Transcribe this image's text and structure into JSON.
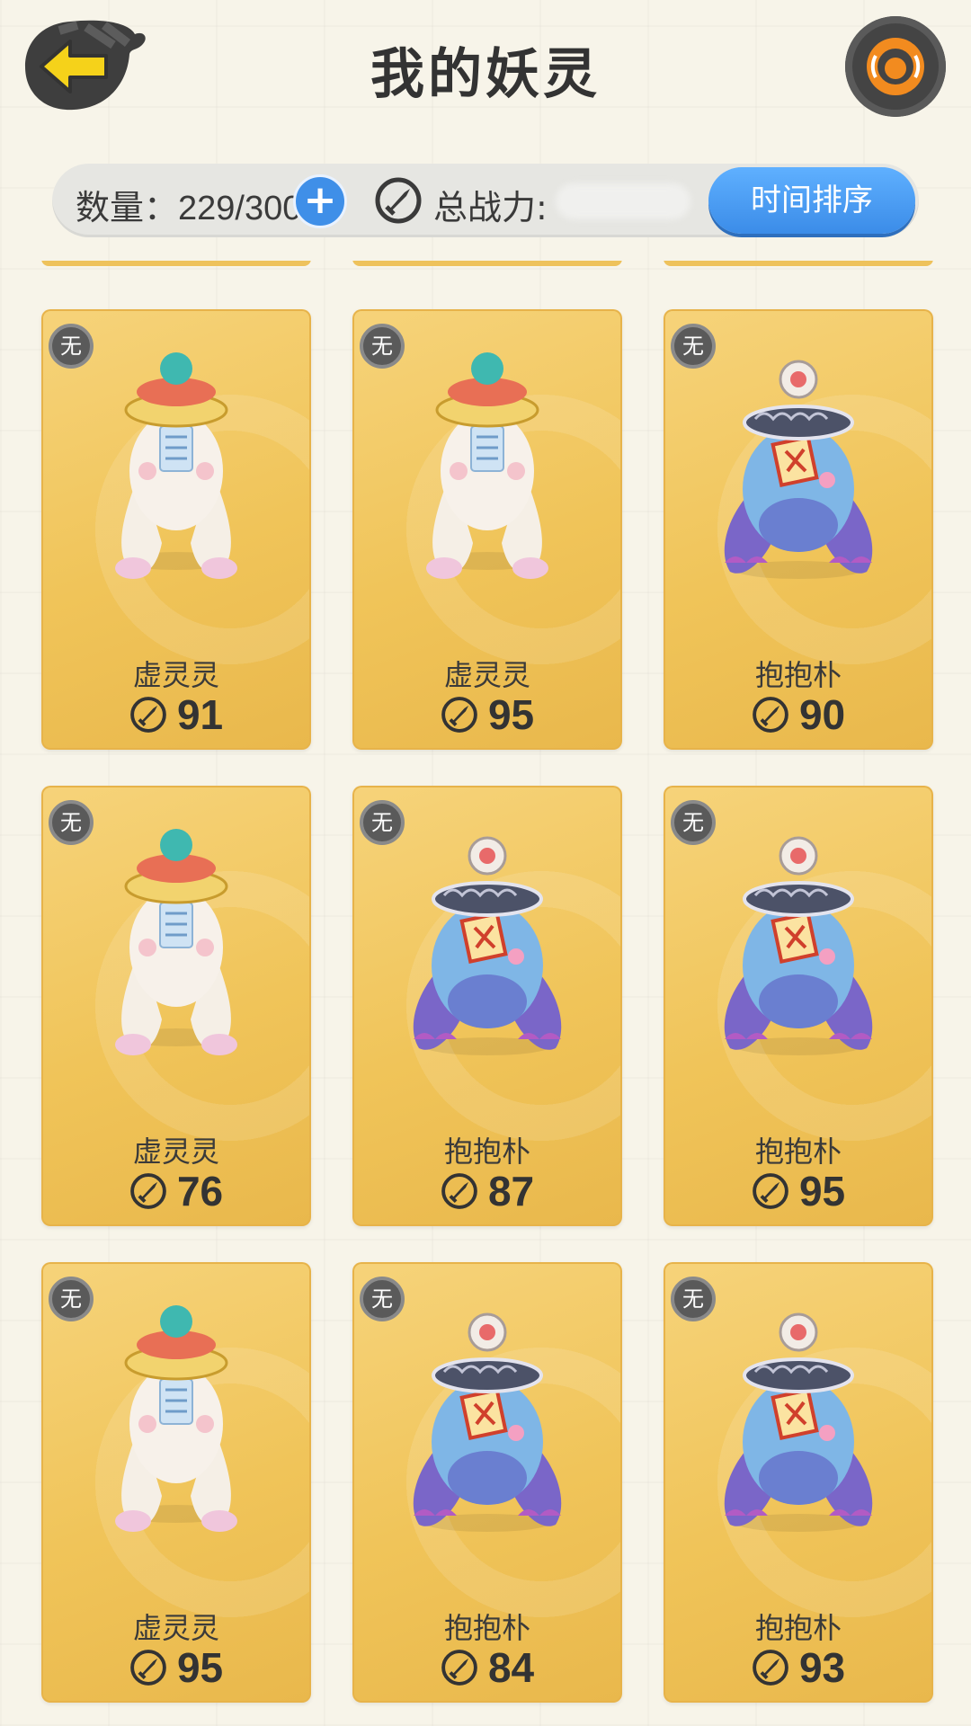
{
  "header": {
    "title": "我的妖灵"
  },
  "stats": {
    "count_label": "数量：229/300",
    "add_symbol": "+",
    "power_label": "总战力:",
    "sort_button": "时间排序"
  },
  "cards": [
    {
      "badge": "无",
      "name": "虚灵灵",
      "power": "91",
      "type": "xuling"
    },
    {
      "badge": "无",
      "name": "虚灵灵",
      "power": "95",
      "type": "xuling"
    },
    {
      "badge": "无",
      "name": "抱抱朴",
      "power": "90",
      "type": "baobao"
    },
    {
      "badge": "无",
      "name": "虚灵灵",
      "power": "76",
      "type": "xuling"
    },
    {
      "badge": "无",
      "name": "抱抱朴",
      "power": "87",
      "type": "baobao"
    },
    {
      "badge": "无",
      "name": "抱抱朴",
      "power": "95",
      "type": "baobao"
    },
    {
      "badge": "无",
      "name": "虚灵灵",
      "power": "95",
      "type": "xuling"
    },
    {
      "badge": "无",
      "name": "抱抱朴",
      "power": "84",
      "type": "baobao"
    },
    {
      "badge": "无",
      "name": "抱抱朴",
      "power": "93",
      "type": "baobao"
    }
  ],
  "colors": {
    "card": "#f0c459",
    "sort_button": "#3b8ce8",
    "back_arrow": "#f5d21a",
    "refresh": "#f28b1f"
  },
  "icons": {
    "back": "back-arrow-icon",
    "refresh": "refresh-pet-icon",
    "power": "sword-shield-icon"
  }
}
